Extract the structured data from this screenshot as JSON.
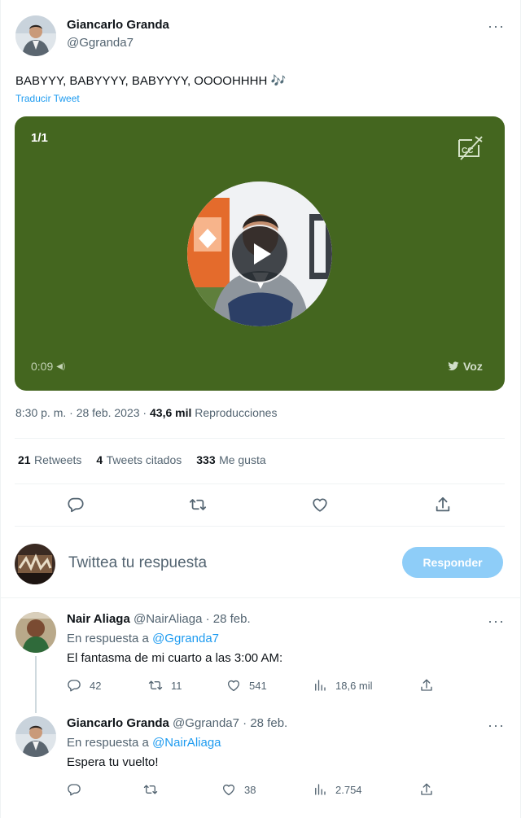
{
  "tweet": {
    "author_name": "Giancarlo Granda",
    "author_handle": "@Ggranda7",
    "text": "BABYYY, BABYYYY, BABYYYY, OOOOHHHH",
    "text_emoji": "🎶",
    "translate_label": "Traducir Tweet",
    "media": {
      "counter": "1/1",
      "duration": "0:09",
      "badge_label": "Voz",
      "background_color": "#44661f"
    },
    "timestamp": "8:30 p. m. · 28 feb. 2023 ·",
    "views_count": "43,6 mil",
    "views_label": "Reproducciones",
    "stats": {
      "retweets_count": "21",
      "retweets_label": "Retweets",
      "quotes_count": "4",
      "quotes_label": "Tweets citados",
      "likes_count": "333",
      "likes_label": "Me gusta"
    }
  },
  "compose": {
    "placeholder": "Twittea tu respuesta",
    "button_label": "Responder"
  },
  "replies": [
    {
      "author_name": "Nair Aliaga",
      "author_handle": "@NairAliaga",
      "date": "· 28 feb.",
      "reply_prefix": "En respuesta a",
      "reply_to": "@Ggranda7",
      "text": "El fantasma de mi cuarto a las 3:00 AM:",
      "reply_count": "42",
      "retweet_count": "11",
      "like_count": "541",
      "view_count": "18,6 mil"
    },
    {
      "author_name": "Giancarlo Granda",
      "author_handle": "@Ggranda7",
      "date": "· 28 feb.",
      "reply_prefix": "En respuesta a",
      "reply_to": "@NairAliaga",
      "text": "Espera tu vuelto!",
      "reply_count": "",
      "retweet_count": "",
      "like_count": "38",
      "view_count": "2.754"
    }
  ],
  "colors": {
    "accent": "#1d9bf0",
    "button_disabled": "#8ecdf8",
    "text_secondary": "#536471"
  }
}
